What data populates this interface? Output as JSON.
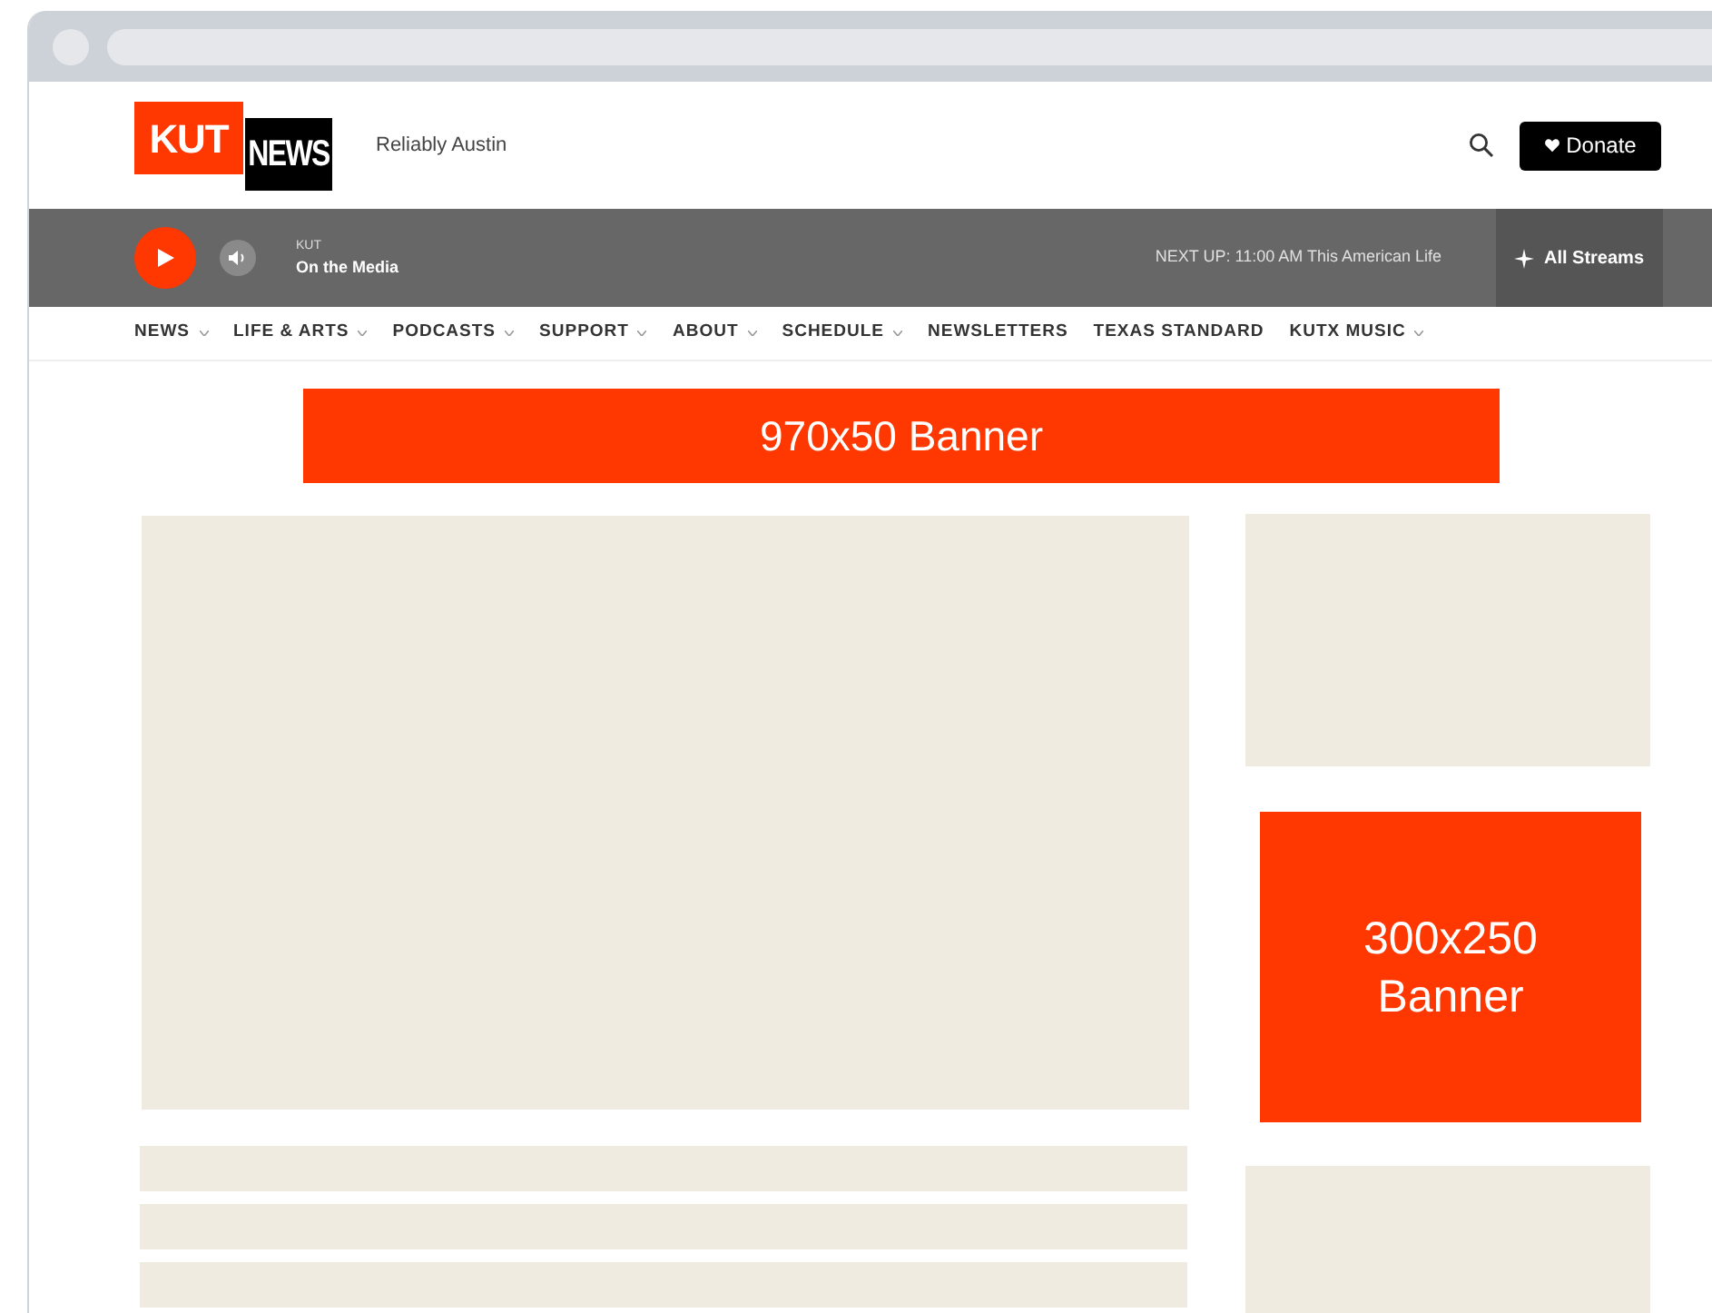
{
  "header": {
    "logo": {
      "part_1": "KUT",
      "part_2": "NEWS"
    },
    "tagline": "Reliably Austin",
    "donate": "Donate"
  },
  "player": {
    "station": "KUT",
    "show": "On the Media",
    "next_up": "NEXT UP: 11:00 AM This American Life",
    "streams": "All Streams"
  },
  "nav": [
    {
      "label": "NEWS",
      "has_menu": true
    },
    {
      "label": "LIFE & ARTS",
      "has_menu": true
    },
    {
      "label": "PODCASTS",
      "has_menu": true
    },
    {
      "label": "SUPPORT",
      "has_menu": true
    },
    {
      "label": "ABOUT",
      "has_menu": true
    },
    {
      "label": "SCHEDULE",
      "has_menu": true
    },
    {
      "label": "NEWSLETTERS",
      "has_menu": false
    },
    {
      "label": "TEXAS STANDARD",
      "has_menu": false
    },
    {
      "label": "KUTX MUSIC",
      "has_menu": true
    }
  ],
  "ads": {
    "top_banner": "970x50 Banner",
    "side_banner": "300x250 Banner"
  }
}
